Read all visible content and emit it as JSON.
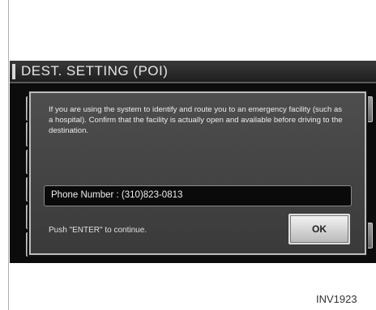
{
  "screen": {
    "title": "DEST. SETTING (POI)"
  },
  "dialog": {
    "message": "If you are using the system to identify and route you to an emergency facility (such as a hospital). Confirm that the facility is actually open and available before driving to the destination.",
    "phone_text": "Phone Number : (310)823-0813",
    "instruction": "Push \"ENTER\" to continue.",
    "ok_label": "OK"
  },
  "figure_code": "INV1923"
}
